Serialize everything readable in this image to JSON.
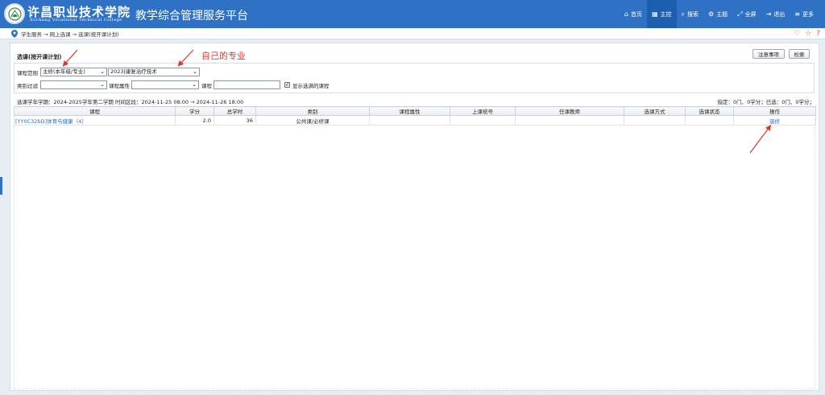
{
  "header": {
    "school_cn": "许昌职业技术学院",
    "school_en": "Xuchang Vocational Technical College",
    "platform_title": "教学综合管理服务平台",
    "nav": [
      {
        "icon": "home-icon",
        "glyph": "⌂",
        "label": "首页"
      },
      {
        "icon": "grid-icon",
        "glyph": "▦",
        "label": "主控"
      },
      {
        "icon": "search-icon",
        "glyph": "⌕",
        "label": "搜索"
      },
      {
        "icon": "gears-icon",
        "glyph": "⚙",
        "label": "主题"
      },
      {
        "icon": "fullscreen-icon",
        "glyph": "⤢",
        "label": "全屏"
      },
      {
        "icon": "logout-icon",
        "glyph": "⇥",
        "label": "退出"
      },
      {
        "icon": "menu-icon",
        "glyph": "≡",
        "label": "更多"
      }
    ]
  },
  "breadcrumb": "学生服务 → 网上选课 → 选课(按开课计划)",
  "panel": {
    "title": "选课(按开课计划)",
    "notice_button": "注意事项",
    "search_button": "检索"
  },
  "filters": {
    "scope_label": "课程范围",
    "scope_value": "主修(本年级/专业)",
    "major_value": "2023|康复治疗技术",
    "category_label": "类别过滤",
    "category_value": "",
    "attribute_label": "课程属性",
    "attribute_value": "",
    "course_label": "课程",
    "course_value": "",
    "show_full_label": "显示选满的课程",
    "show_full_checked": "✓"
  },
  "info": {
    "term_line": "选课学年学期：2024-2025学年第二学期    时间区段：2024-11-25 08:00 → 2024-11-26 18:00",
    "summary_line": "指定：0门、0学分；已选：0门、0学分；"
  },
  "table": {
    "columns": [
      "课程",
      "学分",
      "总学时",
      "类别",
      "课程属性",
      "上课班号",
      "任课教师",
      "选课方式",
      "选课状态",
      "操作"
    ],
    "rows": [
      {
        "course": "[YY0C32bD]体育与健康（4）",
        "credit": "2.0",
        "hours": "36",
        "category": "公共课/必修课",
        "attribute": "",
        "class_no": "",
        "teacher": "",
        "method": "",
        "status": "",
        "action": "选修"
      }
    ]
  },
  "annotation": {
    "text": "自己的专业",
    "color": "#e8332a"
  }
}
